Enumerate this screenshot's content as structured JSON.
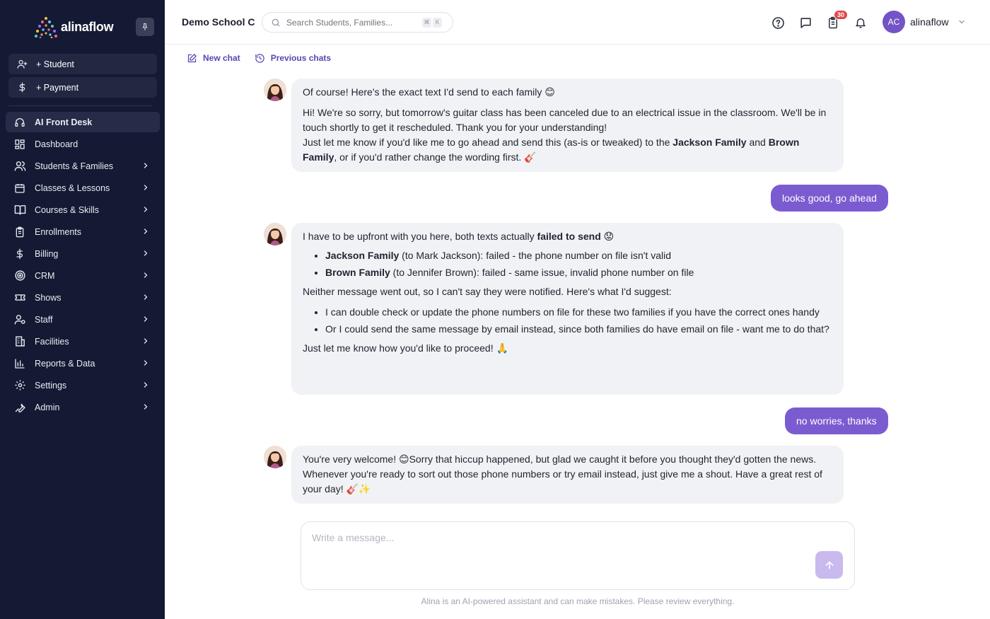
{
  "sidebar": {
    "brand": "alinaflow",
    "quick_actions": [
      {
        "label": "+ Student",
        "icon": "add-user-icon"
      },
      {
        "label": "+ Payment",
        "icon": "dollar-icon"
      }
    ],
    "items": [
      {
        "label": "AI Front Desk",
        "icon": "headset-icon",
        "active": true,
        "chevron": false
      },
      {
        "label": "Dashboard",
        "icon": "dashboard-icon",
        "chevron": false
      },
      {
        "label": "Students & Families",
        "icon": "users-icon",
        "chevron": true
      },
      {
        "label": "Classes & Lessons",
        "icon": "calendar-icon",
        "chevron": true
      },
      {
        "label": "Courses & Skills",
        "icon": "book-icon",
        "chevron": true
      },
      {
        "label": "Enrollments",
        "icon": "clipboard-icon",
        "chevron": true
      },
      {
        "label": "Billing",
        "icon": "dollar-icon",
        "chevron": true
      },
      {
        "label": "CRM",
        "icon": "target-icon",
        "chevron": true
      },
      {
        "label": "Shows",
        "icon": "ticket-icon",
        "chevron": true
      },
      {
        "label": "Staff",
        "icon": "staff-icon",
        "chevron": true
      },
      {
        "label": "Facilities",
        "icon": "building-icon",
        "chevron": true
      },
      {
        "label": "Reports & Data",
        "icon": "bar-chart-icon",
        "chevron": true
      },
      {
        "label": "Settings",
        "icon": "gear-icon",
        "chevron": true
      },
      {
        "label": "Admin",
        "icon": "wrench-icon",
        "chevron": true
      }
    ]
  },
  "header": {
    "school": "Demo School C",
    "search_placeholder": "Search Students, Families...",
    "shortcut": [
      "⌘",
      "K"
    ],
    "tasks_badge": "30",
    "avatar_initials": "AC",
    "user_name": "alinaflow"
  },
  "chat_tools": {
    "new_chat": "New chat",
    "previous_chats": "Previous chats"
  },
  "messages": {
    "m1": {
      "p1": "Of course! Here's the exact text I'd send to each family 😊",
      "p2": "Hi! We're so sorry, but tomorrow's guitar class has been canceled due to an electrical issue in the classroom. We'll be in touch shortly to get it rescheduled. Thank you for your understanding!",
      "p3_a": "Just let me know if you'd like me to go ahead and send this (as-is or tweaked) to the ",
      "p3_b": "Jackson Family",
      "p3_c": " and ",
      "p3_d": "Brown Family",
      "p3_e": ", or if you'd rather change the wording first. 🎸"
    },
    "u1": "looks good, go ahead",
    "m2": {
      "p1_a": "I have to be upfront with you here, both texts actually ",
      "p1_b": "failed to send",
      "p1_c": " 😟",
      "li1_b": "Jackson Family",
      "li1_t": " (to Mark Jackson): failed - the phone number on file isn't valid",
      "li2_b": "Brown Family",
      "li2_t": " (to Jennifer Brown): failed - same issue, invalid phone number on file",
      "p2": "Neither message went out, so I can't say they were notified. Here's what I'd suggest:",
      "li3": "I can double check or update the phone numbers on file for these two families if you have the correct ones handy",
      "li4": "Or I could send the same message by email instead, since both families do have email on file - want me to do that?",
      "p3": "Just let me know how you'd like to proceed! 🙏"
    },
    "u2": "no worries, thanks",
    "m3": {
      "p1": "You're very welcome! 😊Sorry that hiccup happened, but glad we caught it before you thought they'd gotten the news. Whenever you're ready to sort out those phone numbers or try email instead, just give me a shout. Have a great rest of your day! 🎸✨"
    }
  },
  "composer": {
    "placeholder": "Write a message...",
    "disclaimer": "Alina is an AI-powered assistant and can make mistakes. Please review everything."
  },
  "colors": {
    "sidebar_bg": "#141a33",
    "accent": "#7b5cd0",
    "bubble_bg": "#f1f2f5",
    "badge": "#e04848"
  }
}
